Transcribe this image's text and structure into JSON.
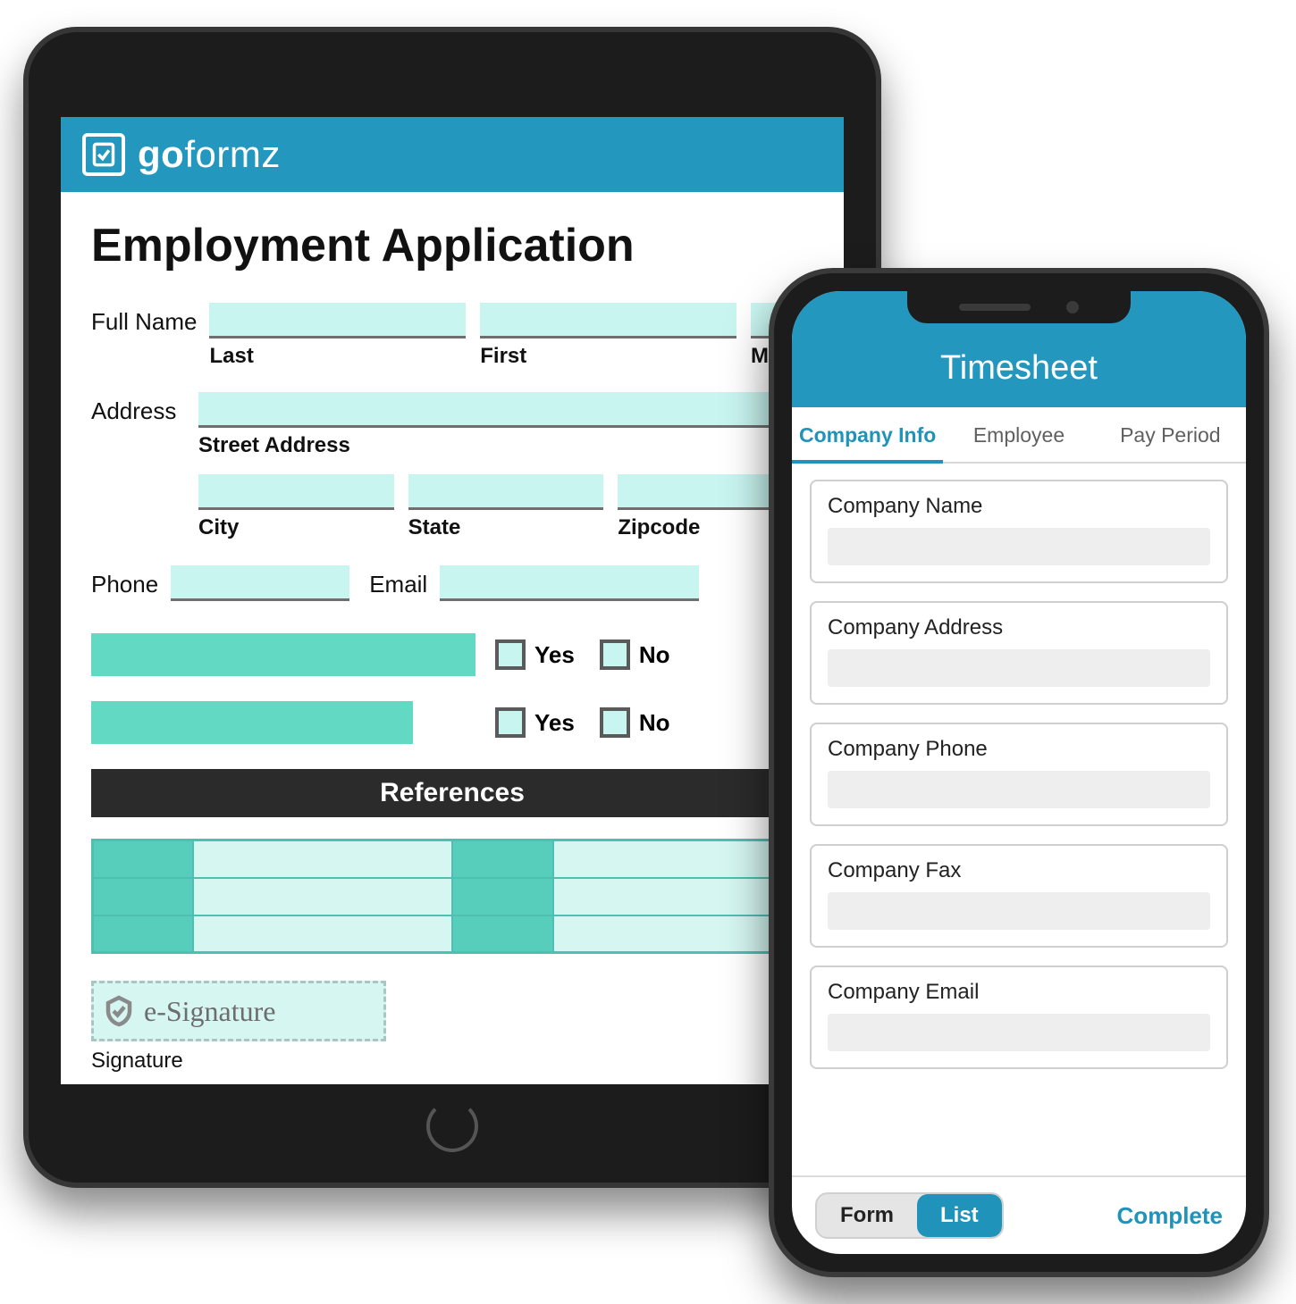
{
  "brand": {
    "name_left": "go",
    "name_right": "formz"
  },
  "tablet": {
    "title": "Employment Application",
    "labels": {
      "full_name": "Full Name",
      "last": "Last",
      "first": "First",
      "mi": "MI",
      "address": "Address",
      "street": "Street Address",
      "city": "City",
      "state": "State",
      "zip": "Zipcode",
      "phone": "Phone",
      "email": "Email",
      "yes": "Yes",
      "no": "No",
      "references": "References",
      "esig": "e-Signature",
      "signature": "Signature"
    }
  },
  "phone": {
    "title": "Timesheet",
    "tabs": [
      "Company Info",
      "Employee",
      "Pay Period"
    ],
    "active_tab": 0,
    "fields": [
      "Company Name",
      "Company Address",
      "Company Phone",
      "Company Fax",
      "Company Email"
    ],
    "footer": {
      "form": "Form",
      "list": "List",
      "complete": "Complete"
    }
  }
}
